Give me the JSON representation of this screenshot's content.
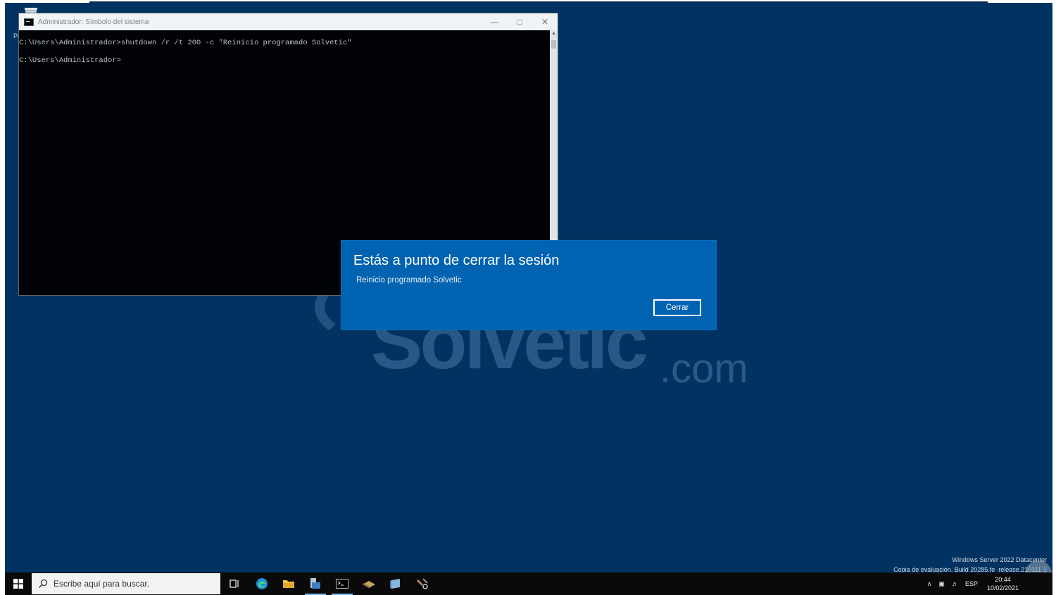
{
  "desktop": {
    "icon_label": "Pap",
    "watermark": {
      "word": "Solvetic",
      "suffix": ".com"
    },
    "server_info": {
      "line1": "Windows Server 2022 Datacenter",
      "line2": "Copia de evaluación. Build 20285.fe_release.210111-1"
    }
  },
  "cmd": {
    "title": "Administrador: Símbolo del sistema",
    "line1": "C:\\Users\\Administrador>shutdown /r /t 200 -c \"Reinicio programado Solvetic\"",
    "line2": "C:\\Users\\Administrador>"
  },
  "dialog": {
    "title": "Estás a punto de cerrar la sesión",
    "message": "Reinicio programado Solvetic",
    "close_label": "Cerrar"
  },
  "taskbar": {
    "search_placeholder": "Escribe aquí para buscar.",
    "lang": "ESP",
    "time": "20:44",
    "date": "10/02/2021"
  }
}
